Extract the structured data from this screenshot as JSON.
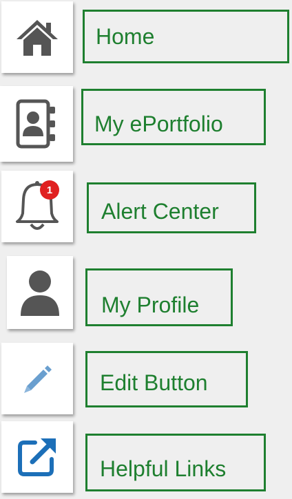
{
  "accent_color": "#1e7f2f",
  "items": [
    {
      "icon": "home-icon",
      "label": "Home"
    },
    {
      "icon": "address-book-icon",
      "label": "My ePortfolio"
    },
    {
      "icon": "bell-icon",
      "label": "Alert Center",
      "badge": "1"
    },
    {
      "icon": "user-icon",
      "label": "My Profile"
    },
    {
      "icon": "pencil-icon",
      "label": "Edit Button"
    },
    {
      "icon": "external-link-icon",
      "label": "Helpful Links"
    }
  ]
}
